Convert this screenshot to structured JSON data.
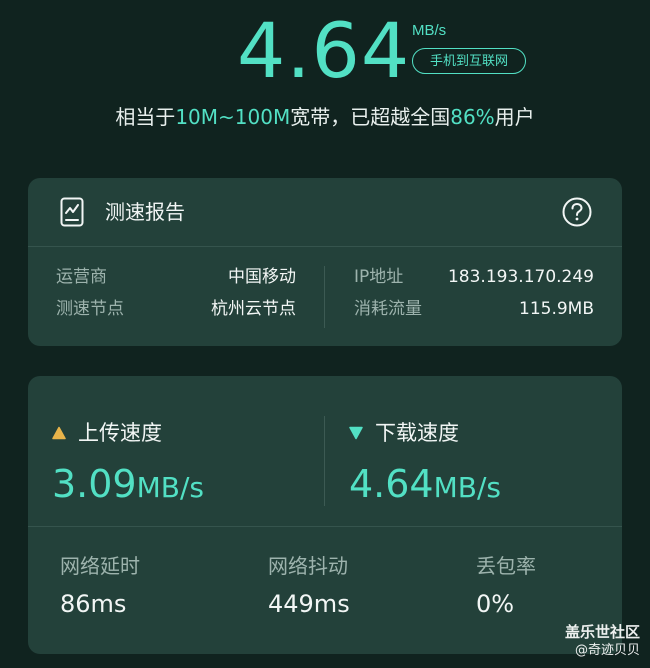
{
  "hero": {
    "speed_value": "4.64",
    "speed_unit": "MB/s",
    "direction_badge": "手机到互联网",
    "summary_prefix": "相当于",
    "summary_bandwidth": "10M~100M",
    "summary_middle": "宽带，已超越全国",
    "summary_percent": "86%",
    "summary_suffix": "用户"
  },
  "report": {
    "title": "测速报告",
    "icons": {
      "report": "speed-report-icon",
      "help": "question-mark-icon"
    },
    "carrier_label": "运营商",
    "carrier_value": "中国移动",
    "node_label": "测速节点",
    "node_value": "杭州云节点",
    "ip_label": "IP地址",
    "ip_value": "183.193.170.249",
    "traffic_label": "消耗流量",
    "traffic_value": "115.9MB"
  },
  "speeds": {
    "upload": {
      "label": "上传速度",
      "value": "3.09",
      "unit": "MB/s",
      "color": "#e8b44a"
    },
    "download": {
      "label": "下载速度",
      "value": "4.64",
      "unit": "MB/s",
      "color": "#52e0c4"
    },
    "metrics": [
      {
        "label": "网络延时",
        "value": "86ms"
      },
      {
        "label": "网络抖动",
        "value": "449ms"
      },
      {
        "label": "丢包率",
        "value": "0%"
      }
    ]
  },
  "watermark": {
    "brand": "盖乐世社区",
    "user": "@奇迹贝贝"
  },
  "colors": {
    "background": "#10231f",
    "card": "#23413a",
    "accent": "#52e0c4",
    "upload_accent": "#e8b44a"
  }
}
